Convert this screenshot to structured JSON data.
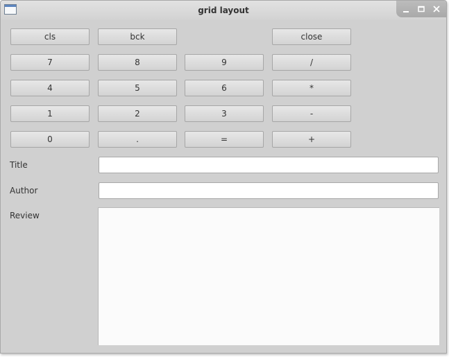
{
  "window": {
    "title": "grid layout",
    "controls": [
      "minimize-icon",
      "maximize-icon",
      "close-icon"
    ]
  },
  "calculator": {
    "buttons": [
      "cls",
      "bck",
      "close",
      "7",
      "8",
      "9",
      "/",
      "4",
      "5",
      "6",
      "*",
      "1",
      "2",
      "3",
      "-",
      "0",
      ".",
      "=",
      "+"
    ]
  },
  "form": {
    "title_label": "Title",
    "title_value": "",
    "author_label": "Author",
    "author_value": "",
    "review_label": "Review",
    "review_value": ""
  }
}
